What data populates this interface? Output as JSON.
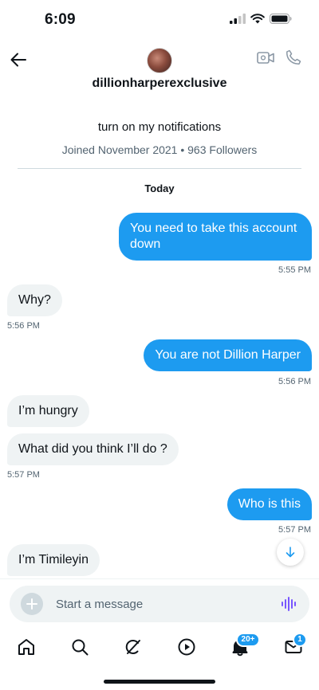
{
  "status_bar": {
    "time": "6:09"
  },
  "header": {
    "username": "dillionharperexclusive"
  },
  "profile": {
    "bio": "turn on my notifications",
    "meta": "Joined November 2021 • 963 Followers"
  },
  "conversation": {
    "day_label": "Today",
    "messages": [
      {
        "direction": "out",
        "text": "You need to take this account down",
        "time": "5:55 PM"
      },
      {
        "direction": "in",
        "text": "Why?",
        "time": "5:56 PM"
      },
      {
        "direction": "out",
        "text": "You are not Dillion Harper",
        "time": "5:56 PM"
      },
      {
        "direction": "in",
        "text": "I’m hungry",
        "time": ""
      },
      {
        "direction": "in",
        "text": "What did you think I’ll do ?",
        "time": "5:57 PM"
      },
      {
        "direction": "out",
        "text": "Who is this",
        "time": "5:57 PM"
      },
      {
        "direction": "in",
        "text": "I’m Timileyin",
        "time": ""
      }
    ]
  },
  "composer": {
    "placeholder": "Start a message",
    "value": ""
  },
  "tabbar": {
    "items": [
      "home",
      "search",
      "grok",
      "communities",
      "notifications",
      "messages"
    ],
    "notifications_badge": "20+",
    "messages_badge": "1"
  },
  "colors": {
    "accent": "#1d9bf0",
    "incoming_bubble": "#eff3f4",
    "secondary_text": "#536471",
    "voice_icon": "#7856ff"
  }
}
